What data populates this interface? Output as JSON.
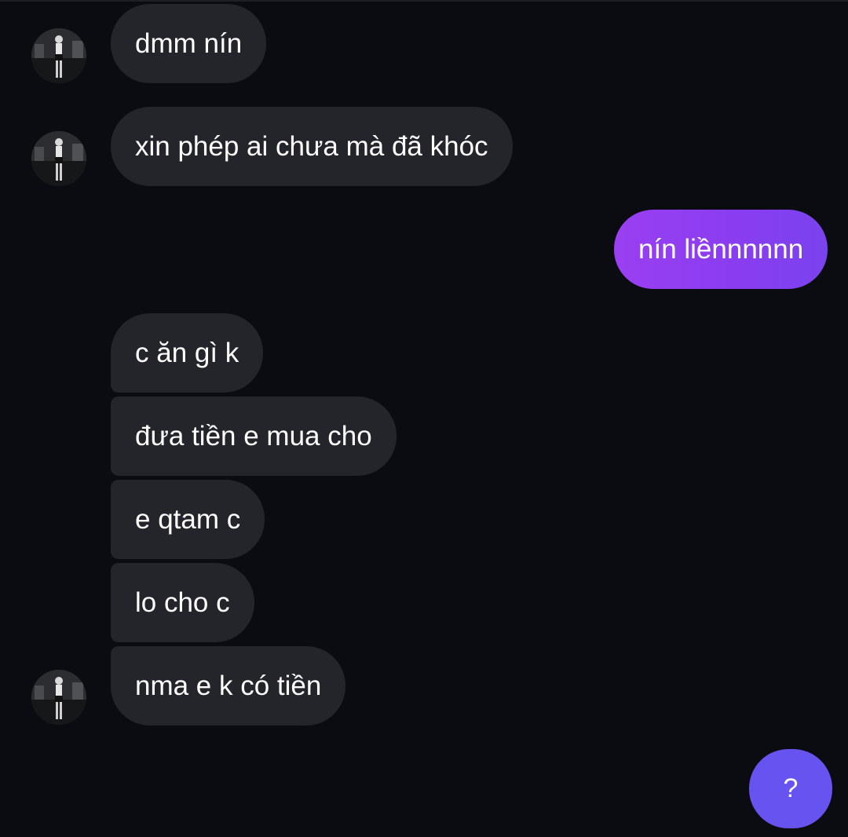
{
  "conversation": {
    "messages": [
      {
        "direction": "incoming",
        "text": "dmm nín",
        "show_avatar": true
      },
      {
        "direction": "incoming",
        "text": "xin phép ai chưa mà đã khóc",
        "show_avatar": true
      },
      {
        "direction": "outgoing",
        "text": "nín liềnnnnnn"
      },
      {
        "direction": "incoming",
        "text": "c ăn gì k",
        "show_avatar": false
      },
      {
        "direction": "incoming",
        "text": "đưa tiền e mua cho",
        "show_avatar": false
      },
      {
        "direction": "incoming",
        "text": "e qtam c",
        "show_avatar": false
      },
      {
        "direction": "incoming",
        "text": "lo cho c",
        "show_avatar": false
      },
      {
        "direction": "incoming",
        "text": "nma e k có tiền",
        "show_avatar": true
      },
      {
        "direction": "outgoing",
        "text": "?"
      }
    ]
  },
  "avatar": {
    "icon": "contact-avatar-icon"
  },
  "colors": {
    "background": "#0b0c11",
    "incoming_bubble": "#23252b",
    "outgoing_bubble": "#8a3df0",
    "last_outgoing_bubble": "#6653f0",
    "text": "#ffffff"
  }
}
